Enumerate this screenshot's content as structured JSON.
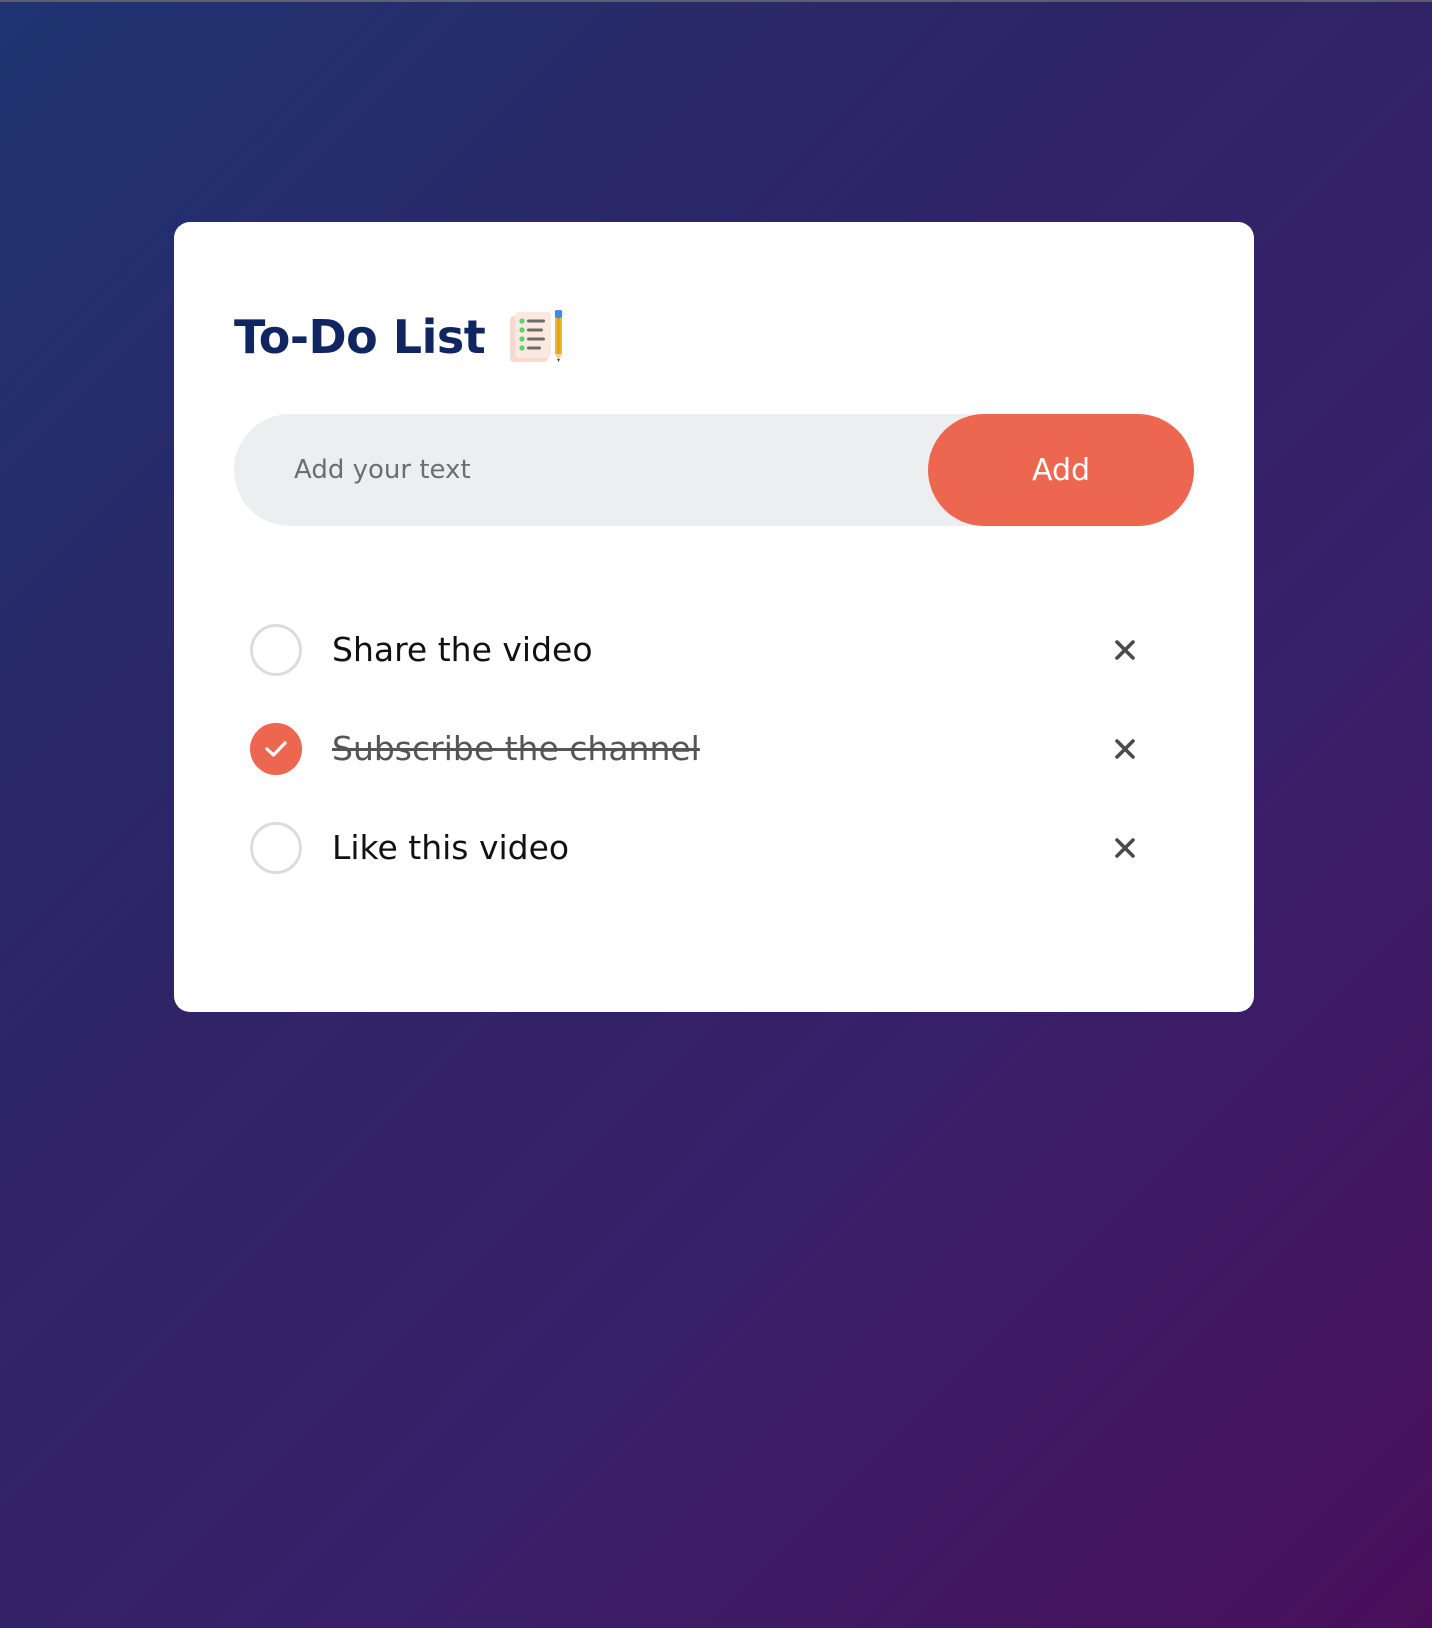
{
  "header": {
    "title": "To-Do List"
  },
  "input": {
    "placeholder": "Add your text",
    "value": ""
  },
  "add_button": {
    "label": "Add"
  },
  "tasks": [
    {
      "label": "Share the video",
      "checked": false
    },
    {
      "label": "Subscribe the channel",
      "checked": true
    },
    {
      "label": "Like this video",
      "checked": false
    }
  ],
  "icons": {
    "title_icon": "notepad-pencil-icon",
    "check_icon": "checkmark-icon",
    "remove_icon": "close-icon"
  },
  "colors": {
    "accent": "#ec6650",
    "title": "#0f2660",
    "input_bg": "#eceef0",
    "background_start": "#1f3472",
    "background_end": "#4a0f5a"
  }
}
